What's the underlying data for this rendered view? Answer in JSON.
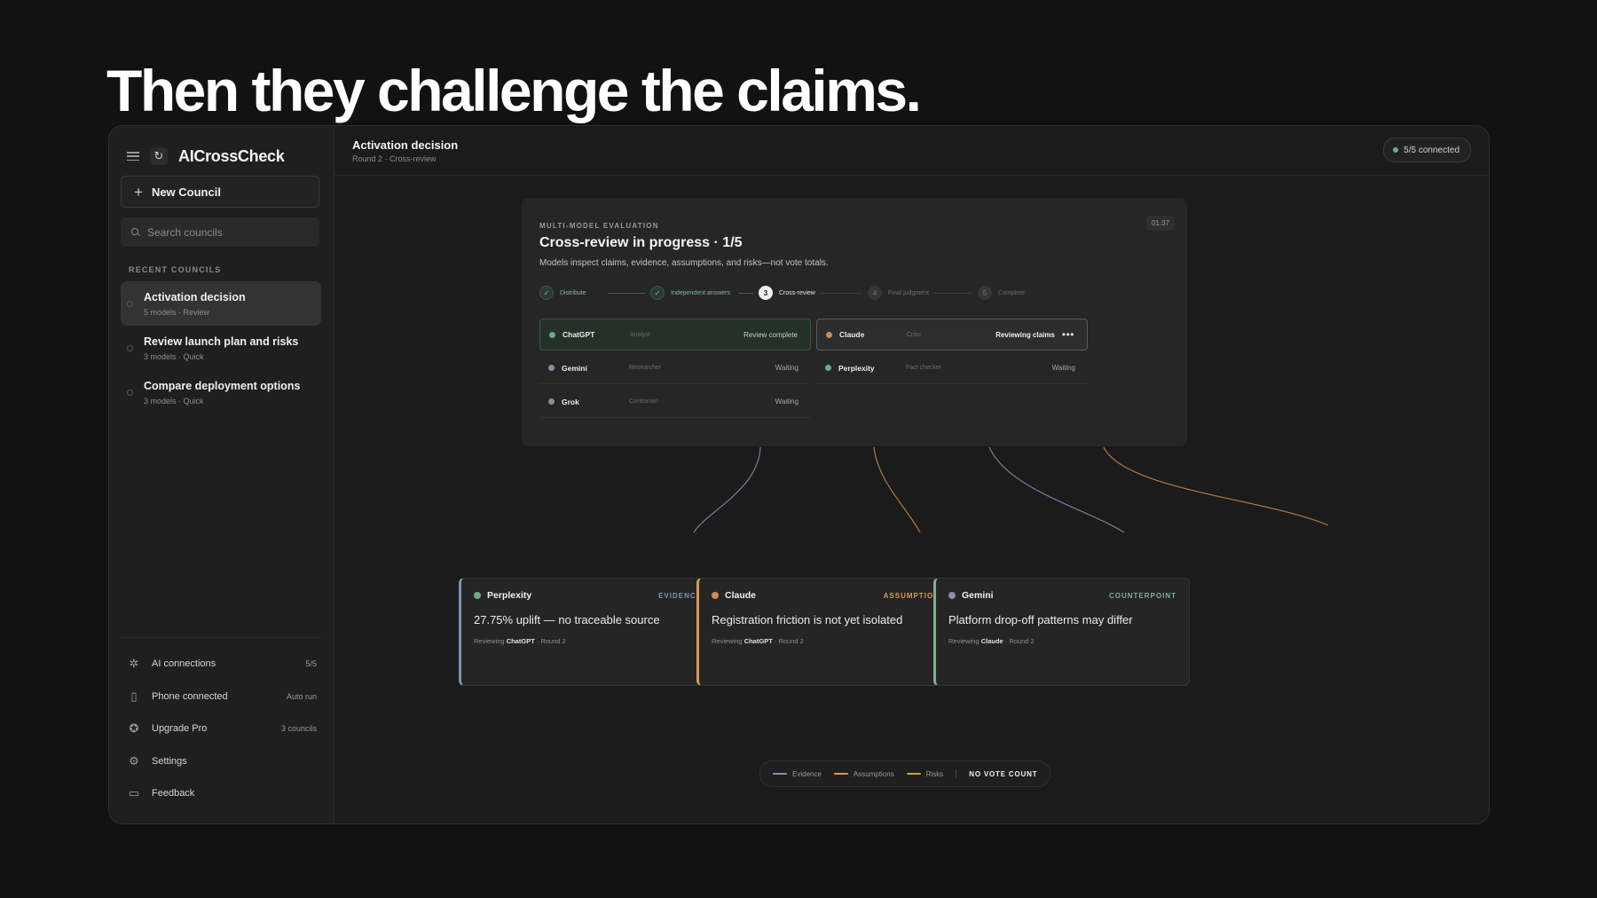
{
  "headline": "Then they challenge the claims.",
  "app": {
    "name": "AICrossCheck",
    "new_council_label": "New Council",
    "search_placeholder": "Search councils",
    "recent_label": "RECENT COUNCILS",
    "recent": [
      {
        "title": "Activation decision",
        "meta": "5 models · Review",
        "active": true
      },
      {
        "title": "Review launch plan and risks",
        "meta": "3 models · Quick",
        "active": false
      },
      {
        "title": "Compare deployment options",
        "meta": "3 models · Quick",
        "active": false
      }
    ],
    "footer": [
      {
        "label": "AI connections",
        "value": "5/5",
        "icon": "network-icon"
      },
      {
        "label": "Phone connected",
        "value": "Auto run",
        "icon": "phone-icon"
      },
      {
        "label": "Upgrade Pro",
        "value": "3 councils",
        "icon": "badge-icon"
      },
      {
        "label": "Settings",
        "value": "",
        "icon": "gear-icon"
      },
      {
        "label": "Feedback",
        "value": "",
        "icon": "feedback-icon"
      }
    ]
  },
  "topbar": {
    "title": "Activation decision",
    "subtitle": "Round 2 · Cross-review",
    "connection": "5/5 connected"
  },
  "panel": {
    "eyebrow": "MULTI-MODEL EVALUATION",
    "time": "01:37",
    "title": "Cross-review in progress · 1/5",
    "description": "Models inspect claims, evidence, assumptions, and risks—not vote totals.",
    "steps": [
      {
        "label": "Distribute",
        "state": "done",
        "marker": "✓"
      },
      {
        "label": "Independent answers",
        "state": "done",
        "marker": "✓"
      },
      {
        "label": "Cross-review",
        "state": "current",
        "marker": "3"
      },
      {
        "label": "Final judgment",
        "state": "todo",
        "marker": "4"
      },
      {
        "label": "Complete",
        "state": "todo",
        "marker": "5"
      }
    ],
    "models": [
      {
        "name": "ChatGPT",
        "role": "Analyst",
        "status": "Review complete",
        "state": "complete",
        "color": "#6fa885"
      },
      {
        "name": "Claude",
        "role": "Critic",
        "status": "Reviewing claims",
        "state": "active",
        "color": "#c98a5a"
      },
      {
        "name": "Gemini",
        "role": "Researcher",
        "status": "Waiting",
        "state": "waiting",
        "color": "#8a8fa8"
      },
      {
        "name": "Perplexity",
        "role": "Fact checker",
        "status": "Waiting",
        "state": "waiting",
        "color": "#6fa885"
      },
      {
        "name": "Grok",
        "role": "Contrarian",
        "status": "Waiting",
        "state": "waiting",
        "color": "#8d8d8d"
      }
    ]
  },
  "cards": [
    {
      "model": "Perplexity",
      "tag": "EVIDENCE",
      "claim": "27.75% uplift — no traceable source",
      "reviewing_prefix": "Reviewing ",
      "reviewing_model": "ChatGPT",
      "round": " · Round 2",
      "accent": "#7f93ad",
      "dot": "#6fa885"
    },
    {
      "model": "Claude",
      "tag": "ASSUMPTION",
      "claim": "Registration friction is not yet isolated",
      "reviewing_prefix": "Reviewing ",
      "reviewing_model": "ChatGPT",
      "round": " · Round 2",
      "accent": "#d69a50",
      "dot": "#c98a5a"
    },
    {
      "model": "Gemini",
      "tag": "COUNTERPOINT",
      "claim": "Platform drop-off patterns may differ",
      "reviewing_prefix": "Reviewing ",
      "reviewing_model": "Claude",
      "round": " · Round 2",
      "accent": "#7fae92",
      "dot": "#8a8fa8"
    }
  ],
  "legend": {
    "items": [
      {
        "label": "Evidence",
        "color": "#7f93ad"
      },
      {
        "label": "Assumptions",
        "color": "#d69a50"
      },
      {
        "label": "Risks",
        "color": "#caa04a"
      }
    ],
    "note": "NO VOTE COUNT"
  },
  "colors": {
    "connector_a": "#7f93ad",
    "connector_b": "#c98a4a"
  }
}
